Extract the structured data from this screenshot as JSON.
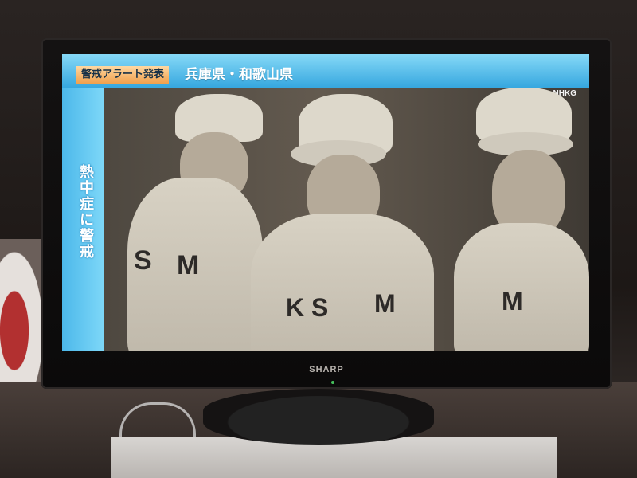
{
  "banner": {
    "alert_label": "警戒アラート発表",
    "region_text": "兵庫県・和歌山県"
  },
  "side_caption": "熱中症に警戒",
  "channel_logo": "NHKG",
  "tv_brand": "SHARP",
  "colors": {
    "banner_blue": "#36a7df",
    "alert_orange": "#f0a04c",
    "photo_sepia": "#635a4f"
  }
}
